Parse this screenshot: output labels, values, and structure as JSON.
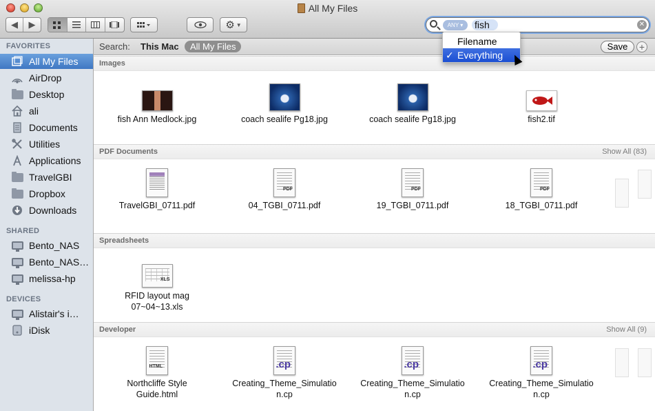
{
  "window": {
    "title": "All My Files"
  },
  "toolbar": {
    "back_icon": "chevron-left-icon",
    "forward_icon": "chevron-right-icon",
    "view_icons": [
      "icon-view-icon",
      "list-view-icon",
      "column-view-icon",
      "coverflow-view-icon"
    ],
    "arrange_icon": "arrange-icon",
    "quicklook_icon": "eye-icon",
    "action_icon": "gear-icon"
  },
  "search": {
    "token_label": "ANY",
    "query": "fish",
    "clear_glyph": "✕"
  },
  "search_menu": {
    "options": [
      {
        "label": "Filename",
        "selected": false
      },
      {
        "label": "Everything",
        "selected": true
      }
    ],
    "check_glyph": "✓"
  },
  "sidebar": {
    "sections": [
      {
        "title": "FAVORITES"
      },
      {
        "title": "SHARED"
      },
      {
        "title": "DEVICES"
      }
    ],
    "favorites": [
      {
        "label": "All My Files",
        "icon": "all-files-icon",
        "selected": true
      },
      {
        "label": "AirDrop",
        "icon": "airdrop-icon"
      },
      {
        "label": "Desktop",
        "icon": "folder-icon"
      },
      {
        "label": "ali",
        "icon": "home-icon"
      },
      {
        "label": "Documents",
        "icon": "documents-icon"
      },
      {
        "label": "Utilities",
        "icon": "utilities-icon"
      },
      {
        "label": "Applications",
        "icon": "applications-icon"
      },
      {
        "label": "TravelGBI",
        "icon": "folder-icon"
      },
      {
        "label": "Dropbox",
        "icon": "folder-icon"
      },
      {
        "label": "Downloads",
        "icon": "downloads-icon"
      }
    ],
    "shared": [
      {
        "label": "Bento_NAS",
        "icon": "display-icon"
      },
      {
        "label": "Bento_NAS…",
        "icon": "display-icon"
      },
      {
        "label": "melissa-hp",
        "icon": "display-icon"
      }
    ],
    "devices": [
      {
        "label": "Alistair's i…",
        "icon": "display-icon"
      },
      {
        "label": "iDisk",
        "icon": "idisk-icon"
      }
    ]
  },
  "scope": {
    "label": "Search:",
    "this_mac": "This Mac",
    "all_my_files": "All My Files",
    "save": "Save",
    "plus": "+"
  },
  "sections": [
    {
      "title": "Images",
      "show_all": "",
      "files": [
        {
          "name": "fish Ann Medlock.jpg",
          "kind": "photo-person"
        },
        {
          "name": "coach sealife Pg18.jpg",
          "kind": "photo-shark"
        },
        {
          "name": "coach sealife Pg18.jpg",
          "kind": "photo-shark"
        },
        {
          "name": "fish2.tif",
          "kind": "photo-fish"
        }
      ]
    },
    {
      "title": "PDF Documents",
      "show_all": "Show All (83)",
      "files": [
        {
          "name": "TravelGBI_0711.pdf",
          "kind": "pdf-magazine",
          "badge": ""
        },
        {
          "name": "04_TGBI_0711.pdf",
          "kind": "pdf",
          "badge": "PDF"
        },
        {
          "name": "19_TGBI_0711.pdf",
          "kind": "pdf",
          "badge": "PDF"
        },
        {
          "name": "18_TGBI_0711.pdf",
          "kind": "pdf",
          "badge": "PDF"
        }
      ]
    },
    {
      "title": "Spreadsheets",
      "show_all": "",
      "files": [
        {
          "name_line1": "RFID layout mag",
          "name_line2": "07~04~13.xls",
          "kind": "xls",
          "badge": "XLS"
        }
      ]
    },
    {
      "title": "Developer",
      "show_all": "Show All (9)",
      "files": [
        {
          "name_line1": "Northcliffe Style",
          "name_line2": "Guide.html",
          "kind": "html",
          "badge": "HTML"
        },
        {
          "name_line1": "Creating_Theme_Simulatio",
          "name_line2": "n.cp",
          "kind": "cp",
          "badge": ".cp"
        },
        {
          "name_line1": "Creating_Theme_Simulatio",
          "name_line2": "n.cp",
          "kind": "cp",
          "badge": ".cp"
        },
        {
          "name_line1": "Creating_Theme_Simulatio",
          "name_line2": "n.cp",
          "kind": "cp",
          "badge": ".cp"
        }
      ]
    }
  ]
}
